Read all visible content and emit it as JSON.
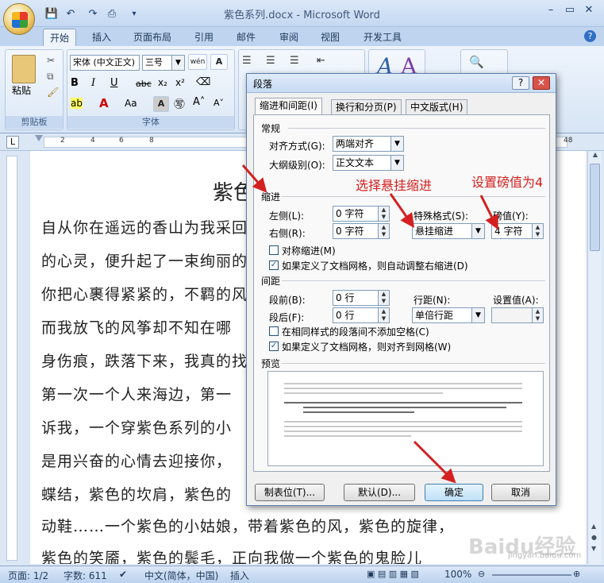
{
  "window": {
    "title": "紫色系列.docx - Microsoft Word"
  },
  "tabs": [
    "开始",
    "插入",
    "页面布局",
    "引用",
    "邮件",
    "审阅",
    "视图",
    "开发工具"
  ],
  "ribbon": {
    "clipboard": {
      "label": "剪贴板",
      "paste": "粘贴"
    },
    "font": {
      "label": "字体",
      "font_name": "宋体 (中文正文)",
      "font_size": "三号",
      "wen": "wén",
      "char_border": "A"
    }
  },
  "ruler": {
    "marks": [
      "2",
      "4",
      "6",
      "8"
    ],
    "right_mark": "48",
    "tab_icon": "L"
  },
  "document": {
    "heading": "紫色",
    "lines": [
      "自从你在遥远的香山为我采回",
      "的心灵，便升起了一束绚丽的",
      "你把心裹得紧紧的，不羁的风",
      "而我放飞的风筝却不知在哪",
      "身伤痕，跌落下来，我真的找",
      "第一次一个人来海边，第一",
      "诉我，一个穿紫色系列的小",
      "是用兴奋的心情去迎接你，",
      "蝶结，紫色的坎肩，紫色的",
      "动鞋……一个紫色的小姑娘，带着紫色的风，紫色的旋律，",
      "紫色的笑靥，紫色的鬓毛，正向我做一个紫色的鬼脸儿"
    ]
  },
  "dialog": {
    "title": "段落",
    "help": "?",
    "close": "✕",
    "tabs": [
      "缩进和间距(I)",
      "换行和分页(P)",
      "中文版式(H)"
    ],
    "general": {
      "section": "常规",
      "alignment_label": "对齐方式(G):",
      "alignment_value": "两端对齐",
      "outline_label": "大纲级别(O):",
      "outline_value": "正文文本"
    },
    "indent": {
      "section": "缩进",
      "left_label": "左侧(L):",
      "left_value": "0 字符",
      "right_label": "右侧(R):",
      "right_value": "0 字符",
      "special_label": "特殊格式(S):",
      "special_value": "悬挂缩进",
      "by_label": "磅值(Y):",
      "by_value": "4 字符",
      "mirror_label": "对称缩进(M)",
      "mirror_checked": false,
      "auto_adjust_label": "如果定义了文档网格，则自动调整右缩进(D)",
      "auto_adjust_checked": true
    },
    "spacing": {
      "section": "间距",
      "before_label": "段前(B):",
      "before_value": "0 行",
      "after_label": "段后(F):",
      "after_value": "0 行",
      "line_label": "行距(N):",
      "line_value": "单倍行距",
      "at_label": "设置值(A):",
      "at_value": "",
      "no_space_label": "在相同样式的段落间不添加空格(C)",
      "no_space_checked": false,
      "snap_grid_label": "如果定义了文档网格，则对齐到网格(W)",
      "snap_grid_checked": true
    },
    "preview": {
      "section": "预览"
    },
    "buttons": {
      "tabs": "制表位(T)...",
      "default": "默认(D)...",
      "ok": "确定",
      "cancel": "取消"
    }
  },
  "annotations": {
    "choose_hanging": "选择悬挂缩进",
    "set_value": "设置磅值为4"
  },
  "statusbar": {
    "page": "页面: 1/2",
    "words": "字数: 611",
    "language": "中文(简体，中国)",
    "mode": "插入",
    "zoom": "100%"
  },
  "watermark": {
    "text": "Baidu经验",
    "url": "jingyan.baidu.com"
  },
  "colors": {
    "annotation": "#d42020",
    "ribbon": "#dbe7f5",
    "dialog_border": "#5a7eb0"
  }
}
